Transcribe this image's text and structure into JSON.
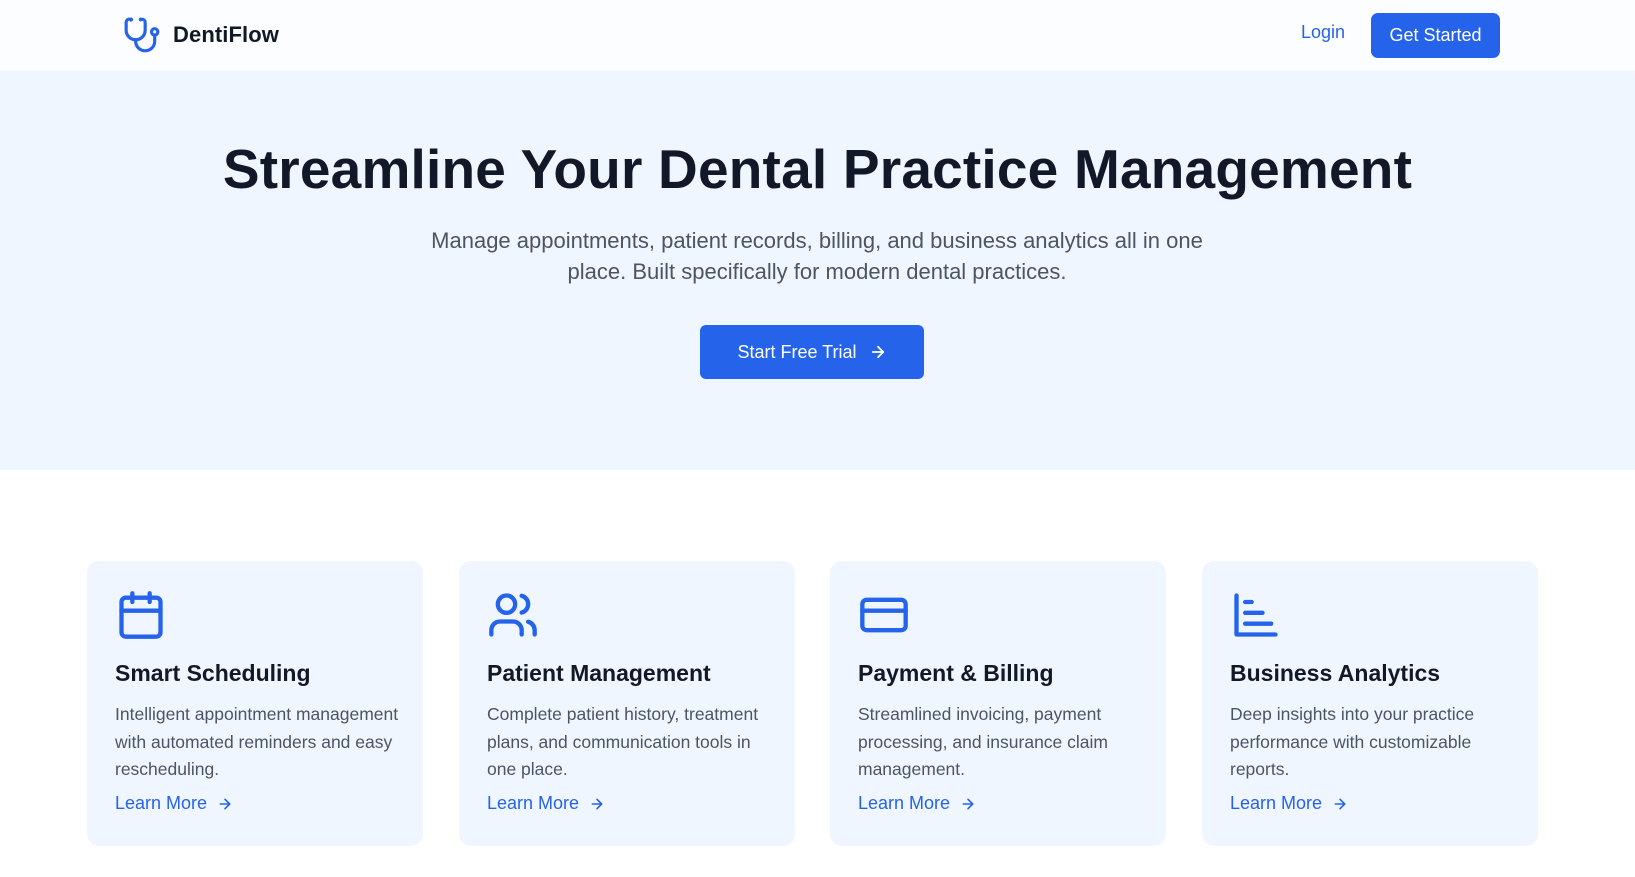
{
  "nav": {
    "brand_icon": "stethoscope-icon",
    "brand_name": "DentiFlow",
    "login_label": "Login",
    "cta_label": "Get Started"
  },
  "hero": {
    "title": "Streamline Your Dental Practice Management",
    "subtitle": "Manage appointments, patient records, billing, and business analytics all in one place. Built specifically for modern dental practices.",
    "cta_label": "Start Free Trial",
    "cta_icon": "arrow-right-icon"
  },
  "features": [
    {
      "icon": "calendar-icon",
      "title": "Smart Scheduling",
      "description": "Intelligent appointment management with automated reminders and easy rescheduling.",
      "link_label": "Learn More"
    },
    {
      "icon": "users-icon",
      "title": "Patient Management",
      "description": "Complete patient history, treatment plans, and communication tools in one place.",
      "link_label": "Learn More"
    },
    {
      "icon": "credit-card-icon",
      "title": "Payment & Billing",
      "description": "Streamlined invoicing, payment processing, and insurance claim management.",
      "link_label": "Learn More"
    },
    {
      "icon": "bar-chart-icon",
      "title": "Business Analytics",
      "description": "Deep insights into your practice performance with customizable reports.",
      "link_label": "Learn More"
    }
  ],
  "colors": {
    "accent": "#2563eb",
    "hero_background": "#eff6ff",
    "card_background": "#eff6ff",
    "heading": "#111827",
    "body_text": "#4b5563"
  }
}
